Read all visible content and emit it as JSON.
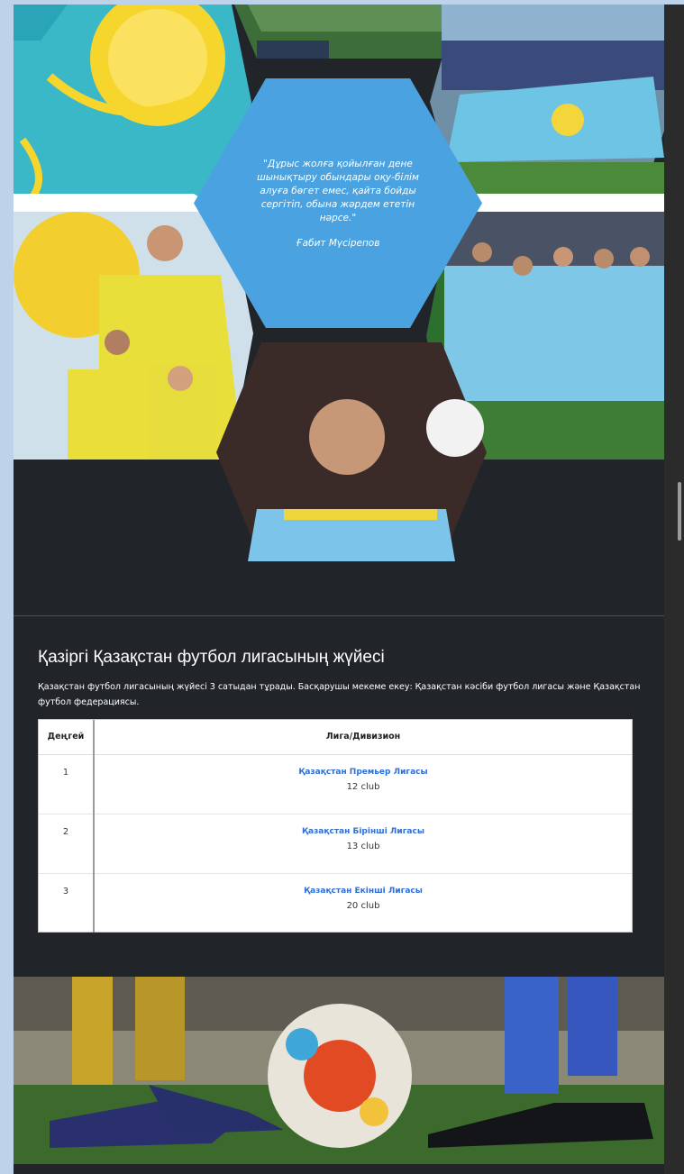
{
  "hero": {
    "quote": "\"Дұрыс жолға қойылған дене шынықтыру обындары оқу-білім алуға бөгет емес, қайта бойды сергітіп, обына жәрдем ететін нәрсе.\"",
    "author": "Ғабит Мүсірепов"
  },
  "league": {
    "title": "Қазіргі Қазақстан футбол лигасының жүйесі",
    "description": "Қазақстан футбол лигасының жүйесі 3 сатыдан тұрады. Басқарушы мекеме екеу: Қазақстан кәсіби футбол лигасы және Қазақстан футбол федерациясы.",
    "table": {
      "headers": [
        "Деңгей",
        "Лига/Дивизион"
      ],
      "rows": [
        {
          "level": "1",
          "name": "Қазақстан Премьер Лигасы",
          "clubs": "12 club"
        },
        {
          "level": "2",
          "name": "Қазақстан Бірінші Лигасы",
          "clubs": "13 club"
        },
        {
          "level": "3",
          "name": "Қазақстан Екінші Лигасы",
          "clubs": "20 club"
        }
      ]
    }
  },
  "colors": {
    "page_bg": "#212529",
    "quote_hex": "#4aa3e0",
    "link": "#2f6fd6",
    "outer_bg": "#bcd3ea"
  },
  "icons": [
    "scrollbar-thumb"
  ]
}
